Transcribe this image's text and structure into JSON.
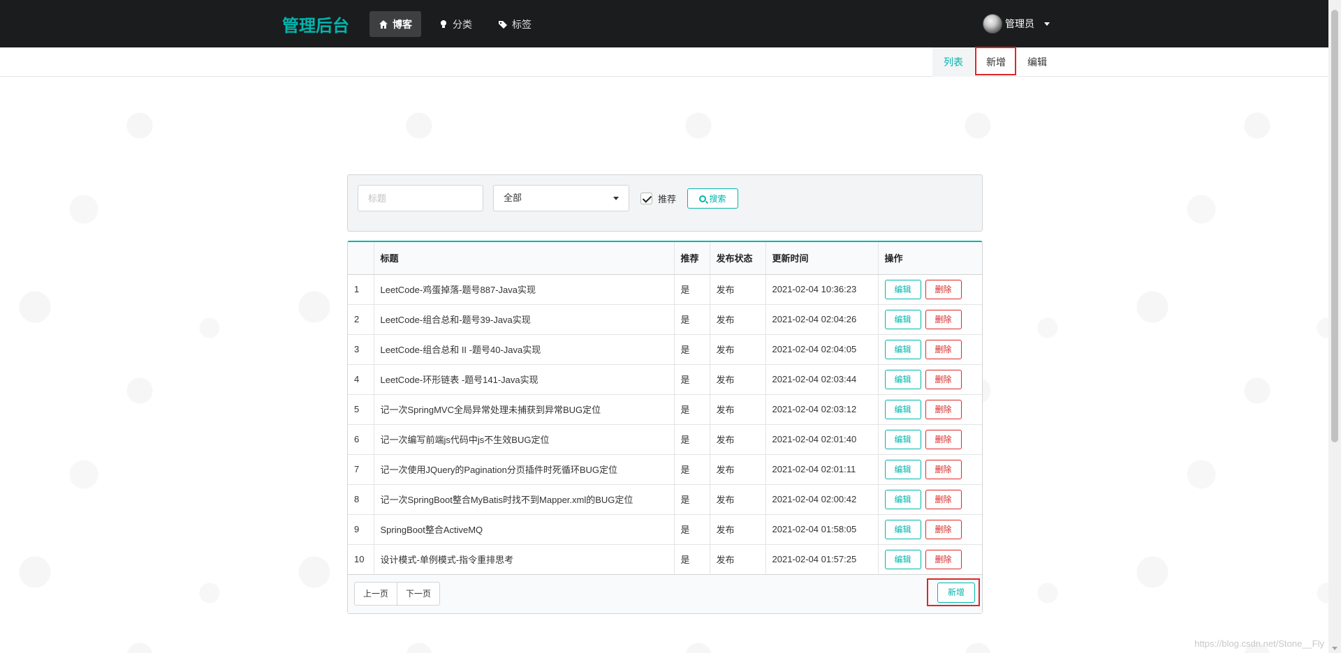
{
  "nav": {
    "brand": "管理后台",
    "items": [
      {
        "label": "博客",
        "icon": "home-icon",
        "active": true
      },
      {
        "label": "分类",
        "icon": "lightbulb-icon",
        "active": false
      },
      {
        "label": "标签",
        "icon": "tags-icon",
        "active": false
      }
    ],
    "user": "管理员"
  },
  "submenu": {
    "list": "列表",
    "new": "新增",
    "edit": "编辑"
  },
  "search": {
    "title_placeholder": "标题",
    "category_selected": "全部",
    "recommend_label": "推荐",
    "recommend_checked": true,
    "search_button": "搜索"
  },
  "table": {
    "headers": [
      "",
      "标题",
      "推荐",
      "发布状态",
      "更新时间",
      "操作"
    ],
    "rows": [
      {
        "idx": "1",
        "title": "LeetCode-鸡蛋掉落-题号887-Java实现",
        "rec": "是",
        "status": "发布",
        "time": "2021-02-04 10:36:23"
      },
      {
        "idx": "2",
        "title": "LeetCode-组合总和-题号39-Java实现",
        "rec": "是",
        "status": "发布",
        "time": "2021-02-04 02:04:26"
      },
      {
        "idx": "3",
        "title": "LeetCode-组合总和 II -题号40-Java实现",
        "rec": "是",
        "status": "发布",
        "time": "2021-02-04 02:04:05"
      },
      {
        "idx": "4",
        "title": "LeetCode-环形链表 -题号141-Java实现",
        "rec": "是",
        "status": "发布",
        "time": "2021-02-04 02:03:44"
      },
      {
        "idx": "5",
        "title": "记一次SpringMVC全局异常处理未捕获到异常BUG定位",
        "rec": "是",
        "status": "发布",
        "time": "2021-02-04 02:03:12"
      },
      {
        "idx": "6",
        "title": "记一次编写前端js代码中js不生效BUG定位",
        "rec": "是",
        "status": "发布",
        "time": "2021-02-04 02:01:40"
      },
      {
        "idx": "7",
        "title": "记一次使用JQuery的Pagination分页插件时死循环BUG定位",
        "rec": "是",
        "status": "发布",
        "time": "2021-02-04 02:01:11"
      },
      {
        "idx": "8",
        "title": "记一次SpringBoot整合MyBatis时找不到Mapper.xml的BUG定位",
        "rec": "是",
        "status": "发布",
        "time": "2021-02-04 02:00:42"
      },
      {
        "idx": "9",
        "title": "SpringBoot整合ActiveMQ",
        "rec": "是",
        "status": "发布",
        "time": "2021-02-04 01:58:05"
      },
      {
        "idx": "10",
        "title": "设计模式-单例模式-指令重排思考",
        "rec": "是",
        "status": "发布",
        "time": "2021-02-04 01:57:25"
      }
    ],
    "edit_label": "编辑",
    "delete_label": "删除",
    "prev_page": "上一页",
    "next_page": "下一页",
    "add_button": "新增"
  },
  "watermark": "https://blog.csdn.net/Stone__Fly",
  "colors": {
    "accent": "#00b5ad",
    "danger": "#db2828",
    "navbar": "#1b1c1d"
  }
}
